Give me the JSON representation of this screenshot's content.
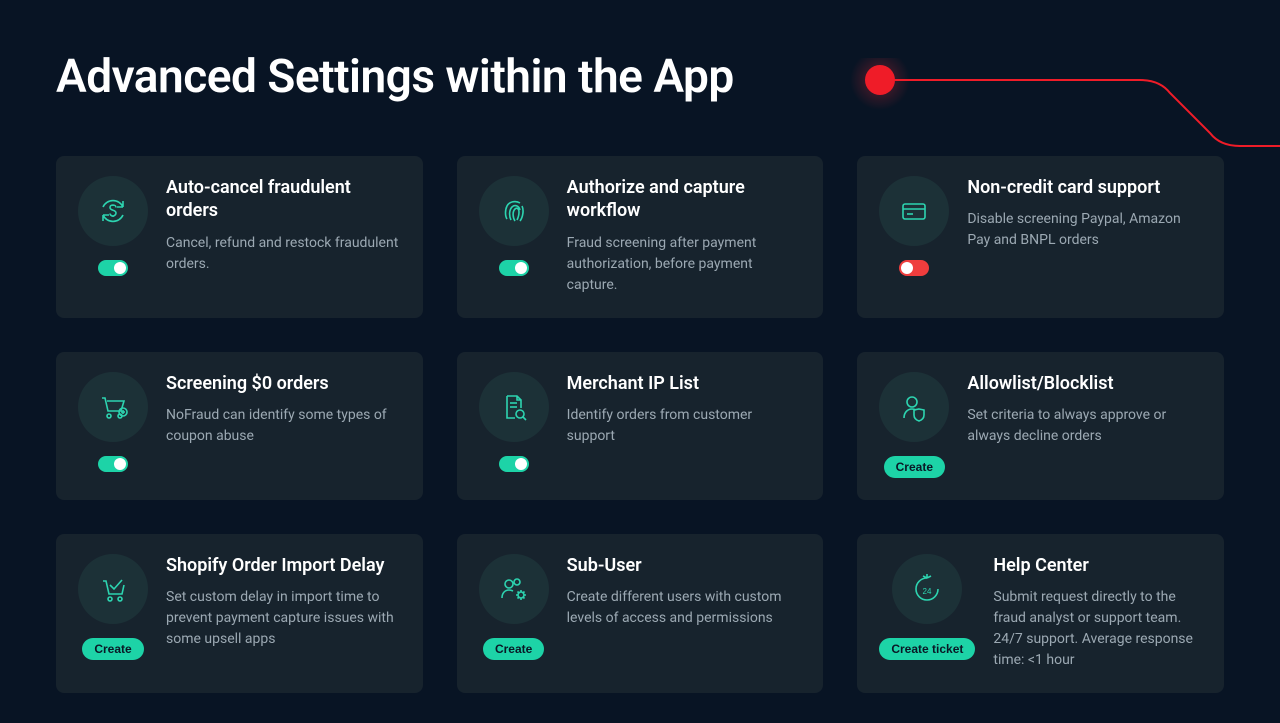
{
  "page": {
    "title": "Advanced Settings within the App"
  },
  "cards": [
    {
      "title": "Auto-cancel fraudulent orders",
      "desc": "Cancel, refund and restock fraudulent orders.",
      "control": "toggle",
      "state": "on"
    },
    {
      "title": "Authorize and capture workflow",
      "desc": "Fraud screening after payment authorization, before payment capture.",
      "control": "toggle",
      "state": "on"
    },
    {
      "title": "Non-credit card support",
      "desc": "Disable screening Paypal, Amazon Pay and BNPL orders",
      "control": "toggle",
      "state": "off"
    },
    {
      "title": "Screening $0 orders",
      "desc": "NoFraud can identify some types of coupon abuse",
      "control": "toggle",
      "state": "on"
    },
    {
      "title": "Merchant IP List",
      "desc": "Identify orders from customer support",
      "control": "toggle",
      "state": "on"
    },
    {
      "title": "Allowlist/Blocklist",
      "desc": "Set criteria to always approve or always decline orders",
      "control": "button",
      "button_label": "Create"
    },
    {
      "title": "Shopify Order Import Delay",
      "desc": "Set custom delay in import time to prevent payment capture issues with some upsell apps",
      "control": "button",
      "button_label": "Create"
    },
    {
      "title": "Sub-User",
      "desc": "Create different users with custom levels of access and permissions",
      "control": "button",
      "button_label": "Create"
    },
    {
      "title": "Help Center",
      "desc": "Submit request directly to the fraud analyst or support team. 24/7 support. Average response time: <1 hour",
      "control": "button",
      "button_label": "Create ticket"
    }
  ]
}
